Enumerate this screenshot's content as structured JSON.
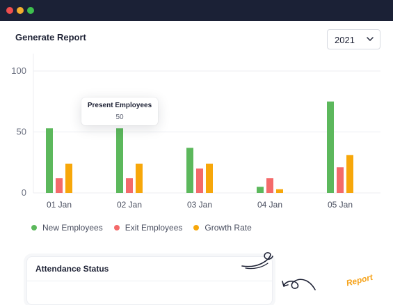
{
  "report": {
    "title": "Generate Report",
    "year": "2021"
  },
  "tooltip": {
    "title": "Present Employees",
    "value": "50"
  },
  "legend": [
    {
      "label": "New Employees",
      "color": "#5cb85c"
    },
    {
      "label": "Exit Employees",
      "color": "#f46a6a"
    },
    {
      "label": "Growth Rate",
      "color": "#f7a70a"
    }
  ],
  "chart_data": {
    "type": "bar",
    "categories": [
      "01 Jan",
      "02 Jan",
      "03 Jan",
      "04 Jan",
      "05 Jan"
    ],
    "series": [
      {
        "name": "New Employees",
        "color": "#5cb85c",
        "values": [
          53,
          53,
          37,
          5,
          75
        ]
      },
      {
        "name": "Exit Employees",
        "color": "#f46a6a",
        "values": [
          12,
          12,
          20,
          12,
          21
        ]
      },
      {
        "name": "Growth Rate",
        "color": "#f7a70a",
        "values": [
          24,
          24,
          24,
          3,
          31
        ]
      }
    ],
    "yticks": [
      0,
      50,
      100
    ],
    "ylim": [
      0,
      100
    ],
    "title": "",
    "xlabel": "",
    "ylabel": "",
    "grid": true,
    "legend_position": "bottom-left"
  },
  "attendance": {
    "title": "Attendance Status"
  },
  "sticker": {
    "text": "Report"
  },
  "window": {
    "buttons": [
      "close",
      "minimize",
      "maximize"
    ]
  }
}
